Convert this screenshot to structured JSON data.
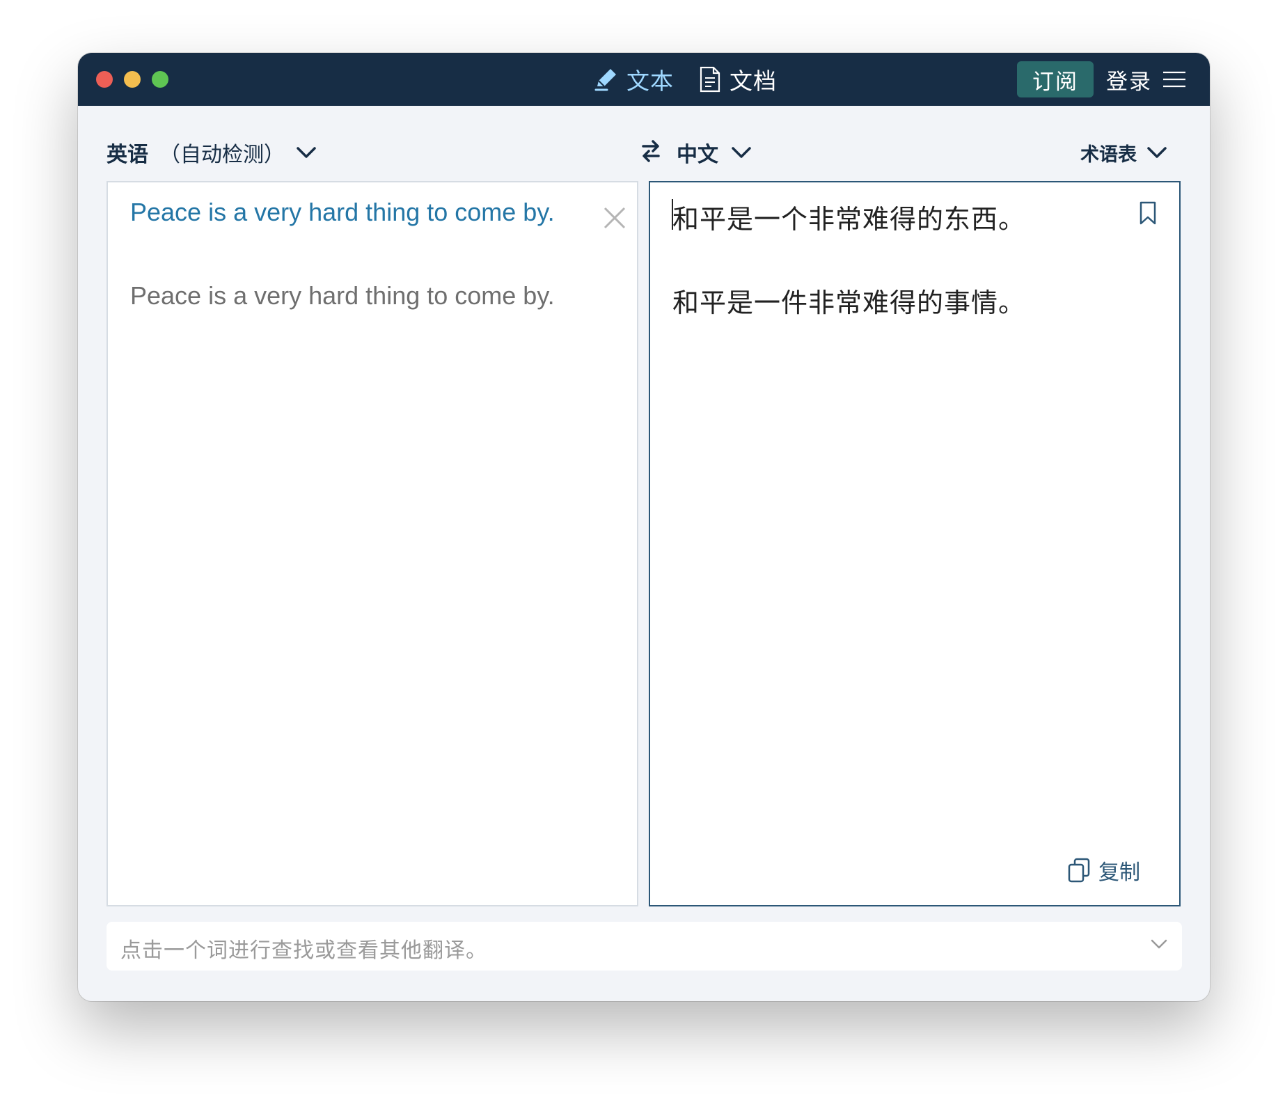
{
  "titlebar": {
    "tabs": [
      {
        "label": "文本",
        "icon": "pencil-icon",
        "active": true
      },
      {
        "label": "文档",
        "icon": "document-icon",
        "active": false
      }
    ],
    "subscribe_label": "订阅",
    "login_label": "登录",
    "menu_icon": "hamburger-menu-icon"
  },
  "languages": {
    "source_name": "英语",
    "source_auto": "（自动检测）",
    "target_name": "中文",
    "glossary_label": "术语表",
    "swap_icon": "swap-icon"
  },
  "source_panel": {
    "text": "Peace is a very hard thing to come by.",
    "alternative": "Peace is a very hard thing to come by."
  },
  "target_panel": {
    "text": "和平是一个非常难得的东西。",
    "alternative": "和平是一件非常难得的事情。",
    "copy_label": "复制"
  },
  "lookup": {
    "placeholder": "点击一个词进行查找或查看其他翻译。"
  },
  "colors": {
    "titlebar": "#172d45",
    "accent_blue": "#2476a6",
    "subscribe": "#2a6a6b",
    "active_tab": "#9fd8ff"
  }
}
